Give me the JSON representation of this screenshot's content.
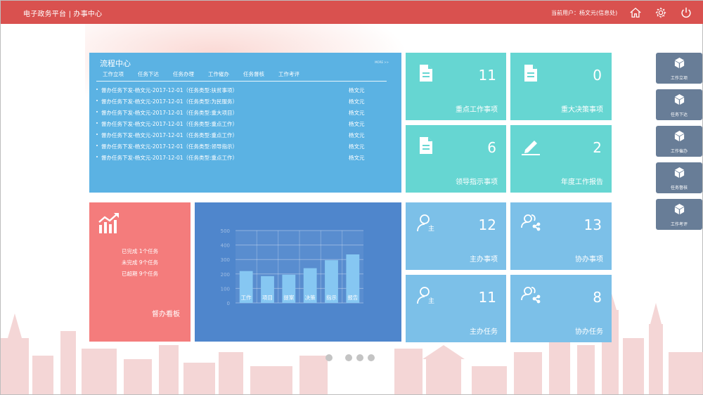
{
  "header": {
    "title": "电子政务平台 | 办事中心",
    "user_text": "当前用户：杨文元(信息处)"
  },
  "process": {
    "title": "流程中心",
    "more": "MORE >>",
    "tabs": [
      "工作立项",
      "任务下达",
      "任务办理",
      "工作催办",
      "任务督核",
      "工作考评"
    ],
    "items": [
      {
        "text": "督办任务下发-杨文元-2017-12-01（任务类型:扶贫事项）",
        "person": "杨文元"
      },
      {
        "text": "督办任务下发-杨文元-2017-12-01（任务类型:为民服务）",
        "person": "杨文元"
      },
      {
        "text": "督办任务下发-杨文元-2017-12-01（任务类型:重大项目）",
        "person": "杨文元"
      },
      {
        "text": "督办任务下发-杨文元-2017-12-01（任务类型:重点工作）",
        "person": "杨文元"
      },
      {
        "text": "督办任务下发-杨文元-2017-12-01（任务类型:重点工作）",
        "person": "杨文元"
      },
      {
        "text": "督办任务下发-杨文元-2017-12-01（任务类型:领导指示）",
        "person": "杨文元"
      },
      {
        "text": "督办任务下发-杨文元-2017-12-01（任务类型:重点工作）",
        "person": "杨文元"
      }
    ]
  },
  "tiles": {
    "key_work": {
      "count": "11",
      "label": "重点工作事项",
      "icon": "document-icon"
    },
    "major_decision": {
      "count": "0",
      "label": "重大决策事项",
      "icon": "document-icon"
    },
    "leader_instruction": {
      "count": "6",
      "label": "领导指示事项",
      "icon": "document-icon"
    },
    "annual_report": {
      "count": "2",
      "label": "年度工作报告",
      "icon": "pen-icon"
    },
    "lead_items": {
      "count": "12",
      "label": "主办事项",
      "icon": "lead-user-icon"
    },
    "assist_items": {
      "count": "13",
      "label": "协办事项",
      "icon": "assist-users-icon"
    },
    "lead_tasks": {
      "count": "11",
      "label": "主办任务",
      "icon": "lead-user-icon"
    },
    "assist_tasks": {
      "count": "8",
      "label": "协办任务",
      "icon": "assist-users-icon"
    }
  },
  "board": {
    "stats": [
      "已完成 1个任务",
      "未完成 9个任务",
      "已超期 9个任务"
    ],
    "label": "督办看板",
    "icon": "trend-chart-icon"
  },
  "sidebar": [
    {
      "label": "工作立项",
      "icon": "cube-icon"
    },
    {
      "label": "任务下达",
      "icon": "cube-icon"
    },
    {
      "label": "工作催办",
      "icon": "cube-icon"
    },
    {
      "label": "任务督核",
      "icon": "cube-icon"
    },
    {
      "label": "工作考评",
      "icon": "cube-icon"
    }
  ],
  "colors": {
    "header": "#d9514f",
    "process_panel": "#5bb2e3",
    "teal_tile": "#66d6d2",
    "blue_tile": "#7cc0e8",
    "board": "#f47c7c",
    "chart_panel": "#4f86cc",
    "sidebar_button": "#687d97"
  },
  "chart_data": {
    "type": "bar",
    "categories": [
      "工作",
      "项目",
      "提案",
      "决策",
      "指示",
      "报告"
    ],
    "values": [
      220,
      185,
      195,
      240,
      295,
      335
    ],
    "yticks": [
      0,
      100,
      200,
      300,
      400,
      500
    ],
    "ylim": [
      0,
      500
    ],
    "grid": true,
    "bar_color": "#86c7f2"
  }
}
